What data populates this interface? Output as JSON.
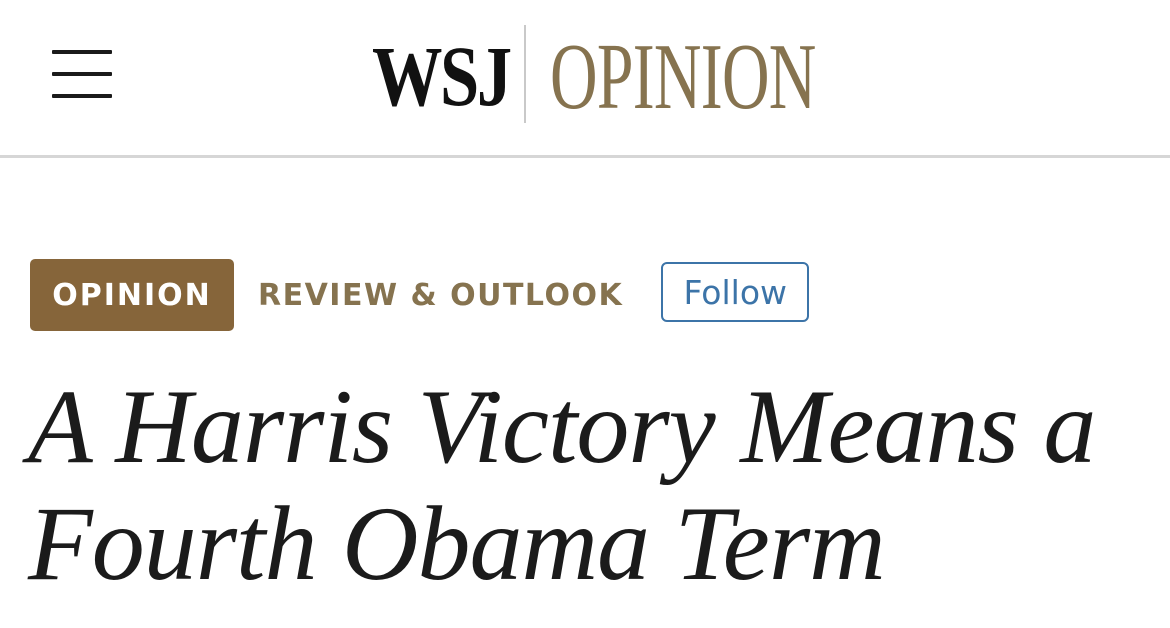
{
  "header": {
    "logo_brand": "WSJ",
    "logo_section": "OPINION",
    "menu_icon": "hamburger-menu-icon"
  },
  "article": {
    "badge": "OPINION",
    "section": "REVIEW & OUTLOOK",
    "follow_label": "Follow",
    "headline": "A Harris Victory Means a Fourth Obama Term"
  },
  "colors": {
    "brand_gold": "#86734f",
    "badge_bg": "#86653a",
    "follow_blue": "#3c74a8",
    "text": "#1b1b1b"
  }
}
